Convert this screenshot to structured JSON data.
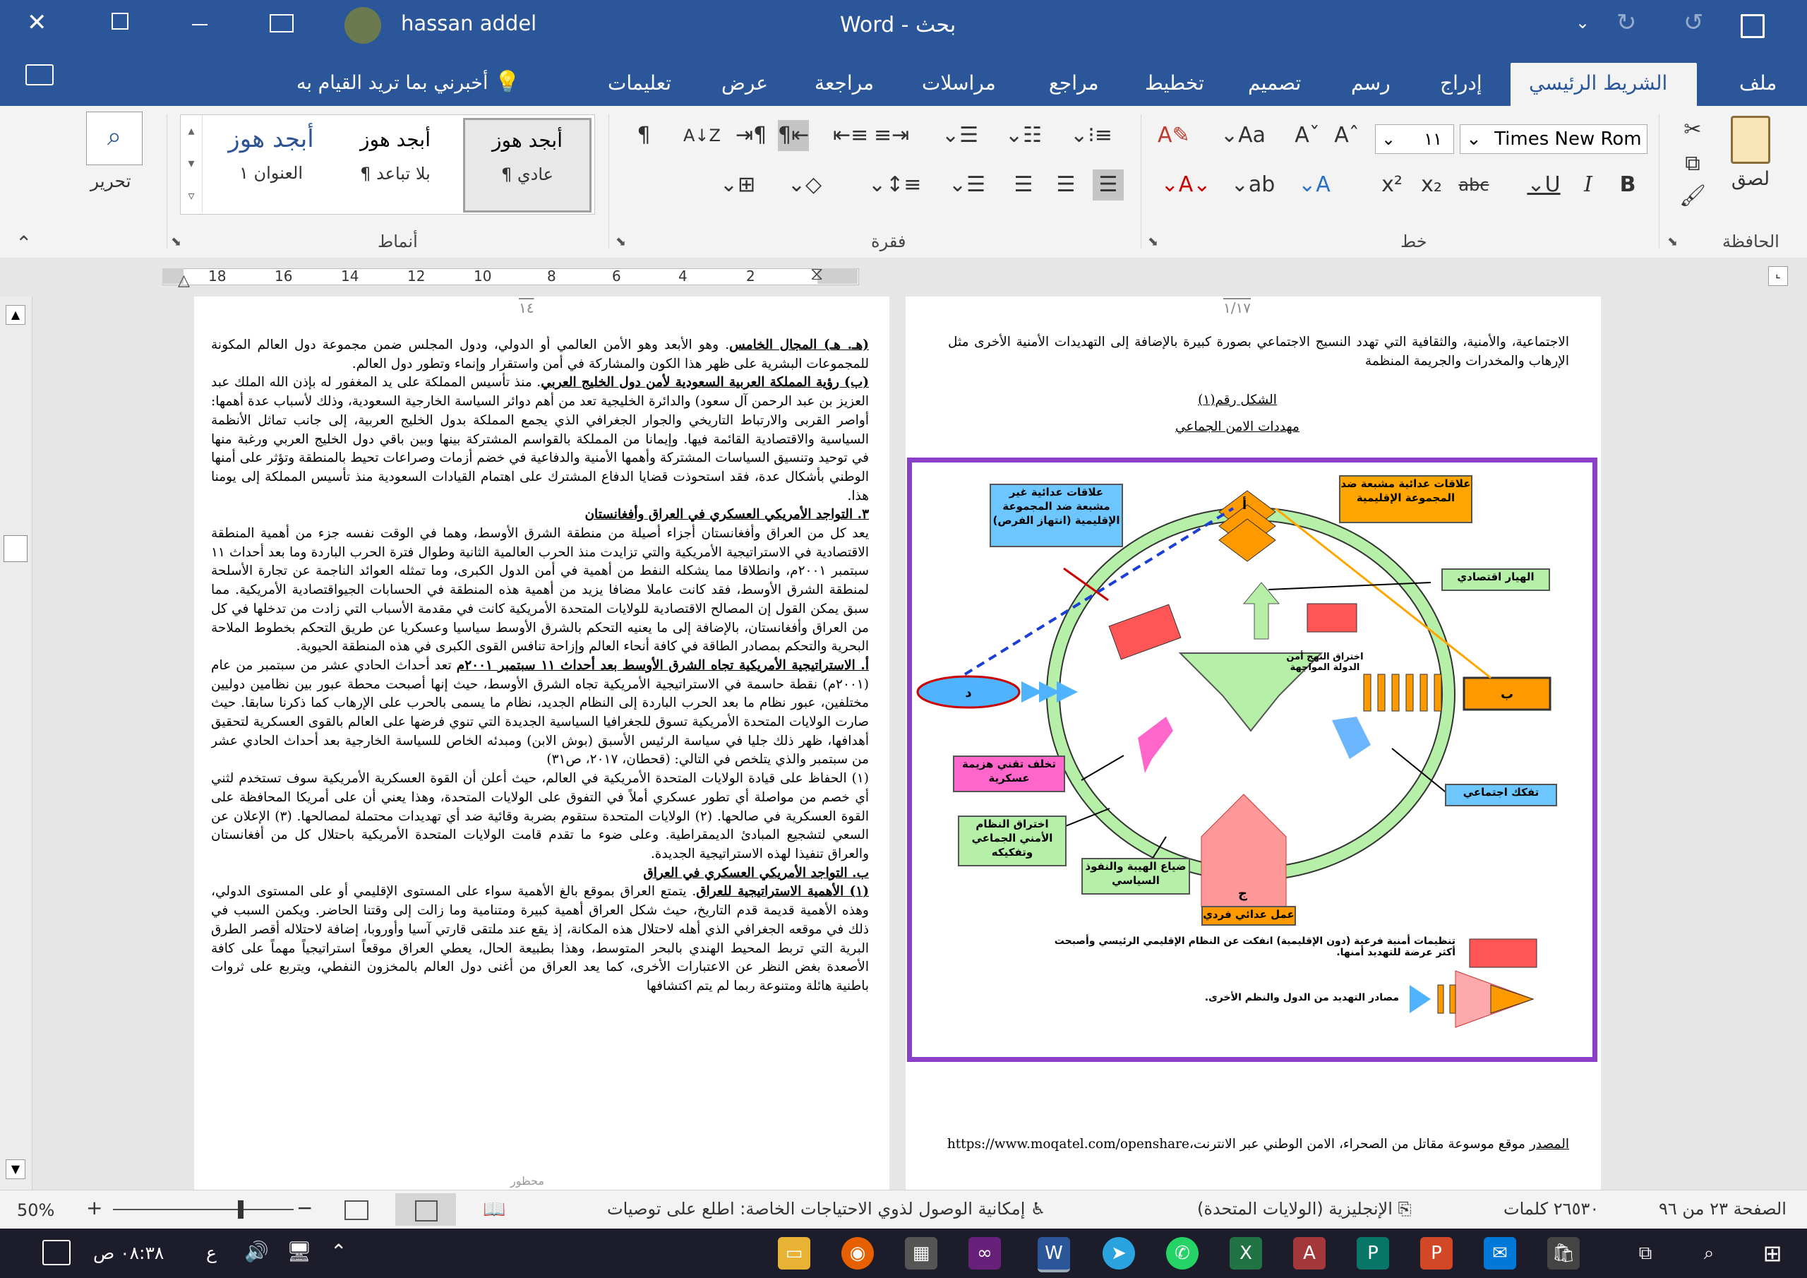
{
  "window": {
    "title": "Word  -  بحث",
    "user": "hassan addel"
  },
  "tabs": [
    "ملف",
    "الشريط الرئيسي",
    "إدراج",
    "رسم",
    "تصميم",
    "تخطيط",
    "مراجع",
    "مراسلات",
    "مراجعة",
    "عرض",
    "تعليمات"
  ],
  "tell_me": "أخبرني بما تريد القيام به",
  "ribbon": {
    "clipboard": {
      "label": "الحافظة",
      "paste": "لصق"
    },
    "font": {
      "label": "خط",
      "name": "Times New Rom",
      "size": "١١"
    },
    "paragraph": {
      "label": "فقرة"
    },
    "styles": {
      "label": "أنماط",
      "items": [
        {
          "preview": "أبجد هوز",
          "name": "¶ عادي"
        },
        {
          "preview": "أبجد هوز",
          "name": "¶ بلا تباعد"
        },
        {
          "preview": "أبجد هوز",
          "name": "العنوان ١"
        }
      ]
    },
    "editing": {
      "label": "تحرير"
    }
  },
  "ruler": {
    "ticks": [
      "2",
      "4",
      "6",
      "8",
      "10",
      "12",
      "14",
      "16",
      "18"
    ]
  },
  "page_left": {
    "number": "١٤",
    "footer": "محظور",
    "paragraphs": [
      {
        "head": "(هـ. هـ) المجال الخامس",
        "text": ". وهو الأبعد وهو الأمن العالمي أو الدولي، ودول المجلس ضمن مجموعة دول العالم المكونة للمجموعات البشرية على ظهر هذا الكون والمشاركة في أمن واستقرار وإنماء وتطور دول العالم."
      },
      {
        "head": "(ب) رؤية المملكة العربية السعودية لأمن دول الخليج العربي",
        "text": ". منذ تأسيس المملكة على يد المغفور له بإذن الله الملك عبد العزيز بن عبد الرحمن آل سعود) والدائرة الخليجية تعد من أهم دوائر السياسة الخارجية السعودية، وذلك لأسباب عدة أهمها: أواصر القربى والارتباط التاريخي والجوار الجغرافي الذي يجمع المملكة بدول الخليج العربية، إلى جانب تماثل الأنظمة السياسية والاقتصادية القائمة فيها. وإيمانا من المملكة بالقواسم المشتركة بينها وبين باقي دول الخليج العربي ورغبة منها في توحيد وتنسيق السياسات المشتركة وأهمها الأمنية والدفاعية في خضم أزمات وصراعات تحيط بالمنطقة وتؤثر على أمنها الوطني بأشكال عدة، فقد استحوذت قضايا الدفاع المشترك على اهتمام القيادات السعودية منذ تأسيس المملكة إلى يومنا هذا."
      },
      {
        "head": "٣. التواجد الأمريكي العسكري في العراق وأفغانستان",
        "text": ""
      },
      {
        "head": "",
        "text": "يعد كل من العراق وأفغانستان أجزاء أصيلة من منطقة الشرق الأوسط، وهما في الوقت نفسه جزء من أهمية المنطقة الاقتصادية في الاستراتيجية الأمريكية والتي تزايدت منذ الحرب العالمية الثانية وطوال فترة الحرب الباردة وما بعد أحداث ١١ سبتمبر ٢٠٠١م، وانطلاقا مما يشكله النفط من أهمية في أمن الدول الكبرى، وما تمثله العوائد الناجمة عن تجارة الأسلحة لمنطقة الشرق الأوسط، فقد كانت عاملا مضافا يزيد من أهمية هذه المنطقة في الحسابات الجيواقتصادية الأمريكية. مما سبق يمكن القول إن المصالح الاقتصادية للولايات المتحدة الأمريكية كانت في مقدمة الأسباب التي زادت من تدخلها في كل من العراق وأفغانستان، بالإضافة إلى ما يعنيه التحكم بالشرق الأوسط سياسيا وعسكريا عن طريق التحكم بخطوط الملاحة البحرية والتحكم بمصادر الطاقة في كافة أنحاء العالم وإزاحة تنافس القوى الكبرى في هذه المنطقة الحيوية."
      },
      {
        "head": "أ. الاستراتيجية الأمريكية تجاه الشرق الأوسط بعد أحداث ١١ سبتمبر ٢٠٠١م",
        "text": " تعد أحداث الحادي عشر من سبتمبر من عام (٢٠٠١م) نقطة حاسمة في الاستراتيجية الأمريكية تجاه الشرق الأوسط، حيث إنها أصبحت محطة عبور بين نظامين دوليين مختلفين، عبور نظام ما بعد الحرب الباردة إلى النظام الجديد، نظام ما يسمى بالحرب على الإرهاب كما ذكرنا سابقا. حيث صارت الولايات المتحدة الأمريكية تسوق للجغرافيا السياسية الجديدة التي تنوي فرضها على العالم بالقوى العسكرية لتحقيق أهدافها، ظهر ذلك جليا في سياسة الرئيس الأسبق (بوش الابن) ومبدئه الخاص للسياسة الخارجية بعد أحداث الحادي عشر من سبتمبر والذي يتلخص في التالي: (قحطان، ٢٠١٧، ص٣١)"
      },
      {
        "head": "",
        "text": "(١) الحفاظ على قيادة الولايات المتحدة الأمريكية في العالم، حيث أعلن أن القوة العسكرية الأمريكية سوف تستخدم لثني أي خصم من مواصلة أي تطور عسكري أملاً في التفوق على الولايات المتحدة، وهذا يعني أن على أمريكا المحافظة على القوة العسكرية في صالحها. (٢) الولايات المتحدة ستقوم بضربة وقائية ضد أي تهديدات محتملة لمصالحها. (٣) الإعلان عن السعي لتشجيع المبادئ الديمقراطية. وعلى ضوء ما تقدم قامت الولايات المتحدة الأمريكية باحتلال كل من أفغانستان والعراق تنفيذا لهذه الاستراتيجية الجديدة."
      },
      {
        "head": "ب. التواجد الأمريكي العسكري في العراق",
        "text": ""
      },
      {
        "head": "(١) الأهمية الاستراتيجية للعراق",
        "text": ". يتمتع العراق بموقع بالغ الأهمية سواء على المستوى الإقليمي أو على المستوى الدولي، وهذه الأهمية قديمة قدم التاريخ، حيث شكل العراق أهمية كبيرة ومتنامية وما زالت إلى وقتنا الحاضر. ويكمن السبب في ذلك في موقعه الجغرافي الذي أهله لاحتلال هذه المكانة، إذ يقع عند ملتقى قارتي آسيا وأوروبا، إضافة لاحتلاله أقصر الطرق البرية التي تربط المحيط الهندي بالبحر المتوسط، وهذا بطبيعة الحال، يعطي العراق موقعاً استراتيجياً مهماً على كافة الأصعدة بغض النظر عن الاعتبارات الأخرى، كما يعد العراق من أغنى دول العالم بالمخزون النفطي، ويتربع على ثروات باطنية هائلة ومتنوعة ربما لم يتم اكتشافها"
      }
    ]
  },
  "page_right": {
    "number": "١/١٧",
    "intro": "الاجتماعية، والأمنية، والثقافية التي تهدد النسيج الاجتماعي بصورة كبيرة بالإضافة إلى التهديدات الأمنية الأخرى مثل الإرهاب والمخدرات والجريمة المنظمة",
    "figure_label": "الشكل رقم(١)",
    "figure_title": "مهددات الامن الجماعي",
    "diagram": {
      "boxes": [
        "علاقات عدائية مشبعة ضد المجموعة الإقليمية",
        "علاقات عدائية غير مشبعة ضد المجموعة الإقليمية (انتهاز الفرص)",
        "الهيار اقتصادي",
        "تفكك اجتماعي",
        "تخلف تقني هزيمة عسكرية",
        "اختراق النظام الأمني الجماعي وتفكيكه",
        "ضياع الهيبة والنفوذ السياسي",
        "عمل عدائي فردي",
        "اختراق النهج أمن الدولة المواجهة"
      ],
      "letters": [
        "أ",
        "ب",
        "ج",
        "د"
      ],
      "legend": [
        "تنظيمات أمنية فرعية (دون الإقليمية) انفكت عن النظام الإقليمي الرئيسي وأصبحت أكثر عرضة للتهديد أمنها.",
        "مصادر التهديد من الدول والنظم الأخرى."
      ]
    },
    "source_label": "المصدر",
    "source_text": " موقع موسوعة مقاتل من الصحراء، الامن الوطني عبر الانترنت،https://www.moqatel.com/openshare"
  },
  "status": {
    "page": "الصفحة ٢٣ من ٩٦",
    "words": "٢٦٥٣٠ كلمات",
    "language": "الإنجليزية (الولايات المتحدة)",
    "accessibility": "إمكانية الوصول لذوي الاحتياجات الخاصة: اطلع على توصيات",
    "zoom": "50%"
  },
  "taskbar": {
    "time": "٠٨:٣٨ ص",
    "lang": "ع"
  },
  "colors": {
    "accent": "#2b579a",
    "taskbar": "#1c1c2a",
    "diagram_border": "#8b3fc9"
  }
}
